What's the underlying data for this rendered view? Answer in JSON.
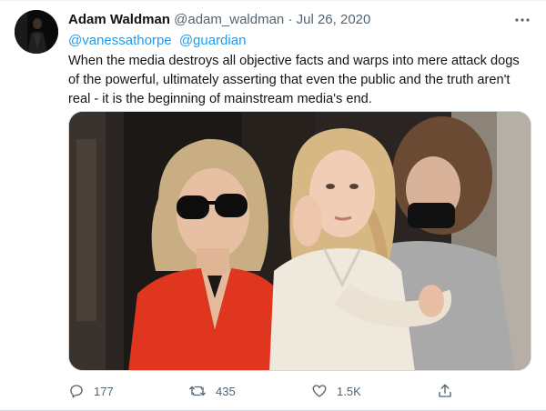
{
  "tweet": {
    "author_name": "Adam Waldman",
    "author_handle": "@adam_waldman",
    "separator": "·",
    "date": "Jul 26, 2020",
    "mentions": [
      "@vanessathorpe",
      "@guardian"
    ],
    "text": "When the media destroys all objective facts and warps into mere attack dogs of the powerful, ultimately asserting that even the public and the truth aren't real - it is the beginning of mainstream media's end."
  },
  "actions": {
    "replies": "177",
    "retweets": "435",
    "likes": "1.5K"
  },
  "icons": {
    "more": "more-horizontal-icon",
    "reply": "reply-icon",
    "retweet": "retweet-icon",
    "like": "heart-icon",
    "share": "share-icon"
  },
  "colors": {
    "link": "#1d9bf0",
    "secondary_text": "#536471",
    "text": "#0f1419",
    "border": "#cfd9de"
  }
}
